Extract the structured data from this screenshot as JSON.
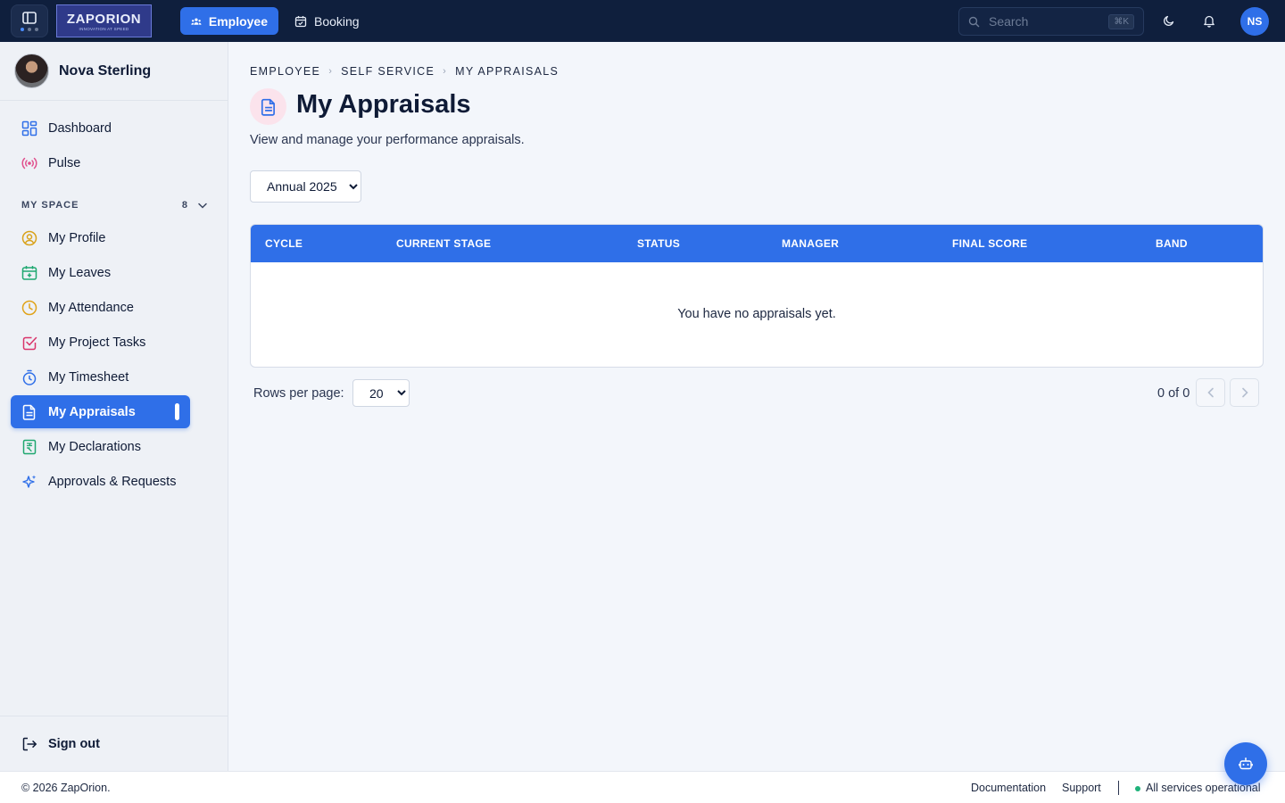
{
  "topbar": {
    "logo_text": "ZAPORION",
    "logo_tagline": "INNOVATION AT SPEED",
    "tabs": [
      {
        "label": "Employee",
        "icon": "users-icon",
        "active": true
      },
      {
        "label": "Booking",
        "icon": "calendar-check-icon",
        "active": false
      }
    ],
    "search": {
      "placeholder": "Search",
      "shortcut": "⌘K"
    },
    "user_initials": "NS"
  },
  "sidebar": {
    "user_name": "Nova Sterling",
    "top_items": [
      {
        "label": "Dashboard",
        "icon": "grid-icon"
      },
      {
        "label": "Pulse",
        "icon": "broadcast-icon"
      }
    ],
    "section": {
      "label": "MY SPACE",
      "count": "8"
    },
    "items": [
      {
        "label": "My Profile",
        "icon": "user-circle-icon"
      },
      {
        "label": "My Leaves",
        "icon": "calendar-plus-icon"
      },
      {
        "label": "My Attendance",
        "icon": "clock-icon"
      },
      {
        "label": "My Project Tasks",
        "icon": "check-square-icon"
      },
      {
        "label": "My Timesheet",
        "icon": "stopwatch-icon"
      },
      {
        "label": "My Appraisals",
        "icon": "document-icon",
        "active": true
      },
      {
        "label": "My Declarations",
        "icon": "rupee-receipt-icon"
      },
      {
        "label": "Approvals & Requests",
        "icon": "sparkles-icon"
      }
    ],
    "sign_out": "Sign out"
  },
  "main": {
    "breadcrumb": [
      "EMPLOYEE",
      "SELF SERVICE",
      "MY APPRAISALS"
    ],
    "title": "My Appraisals",
    "subtitle": "View and manage your performance appraisals.",
    "cycle_select": {
      "value": "Annual 2025",
      "options": [
        "Annual 2025"
      ]
    },
    "table": {
      "columns": [
        "CYCLE",
        "CURRENT STAGE",
        "STATUS",
        "MANAGER",
        "FINAL SCORE",
        "BAND"
      ],
      "rows": [],
      "empty_message": "You have no appraisals yet."
    },
    "pagination": {
      "rows_per_page_label": "Rows per page:",
      "rows_per_page": "20",
      "range": "0 of 0"
    }
  },
  "footer": {
    "copyright": "© 2026 ZapOrion.",
    "links": [
      "Documentation",
      "Support"
    ],
    "status": "All services operational"
  },
  "colors": {
    "accent": "#2f6fe8",
    "topbar": "#0f1f3d",
    "status_ok": "#1fb27a"
  }
}
